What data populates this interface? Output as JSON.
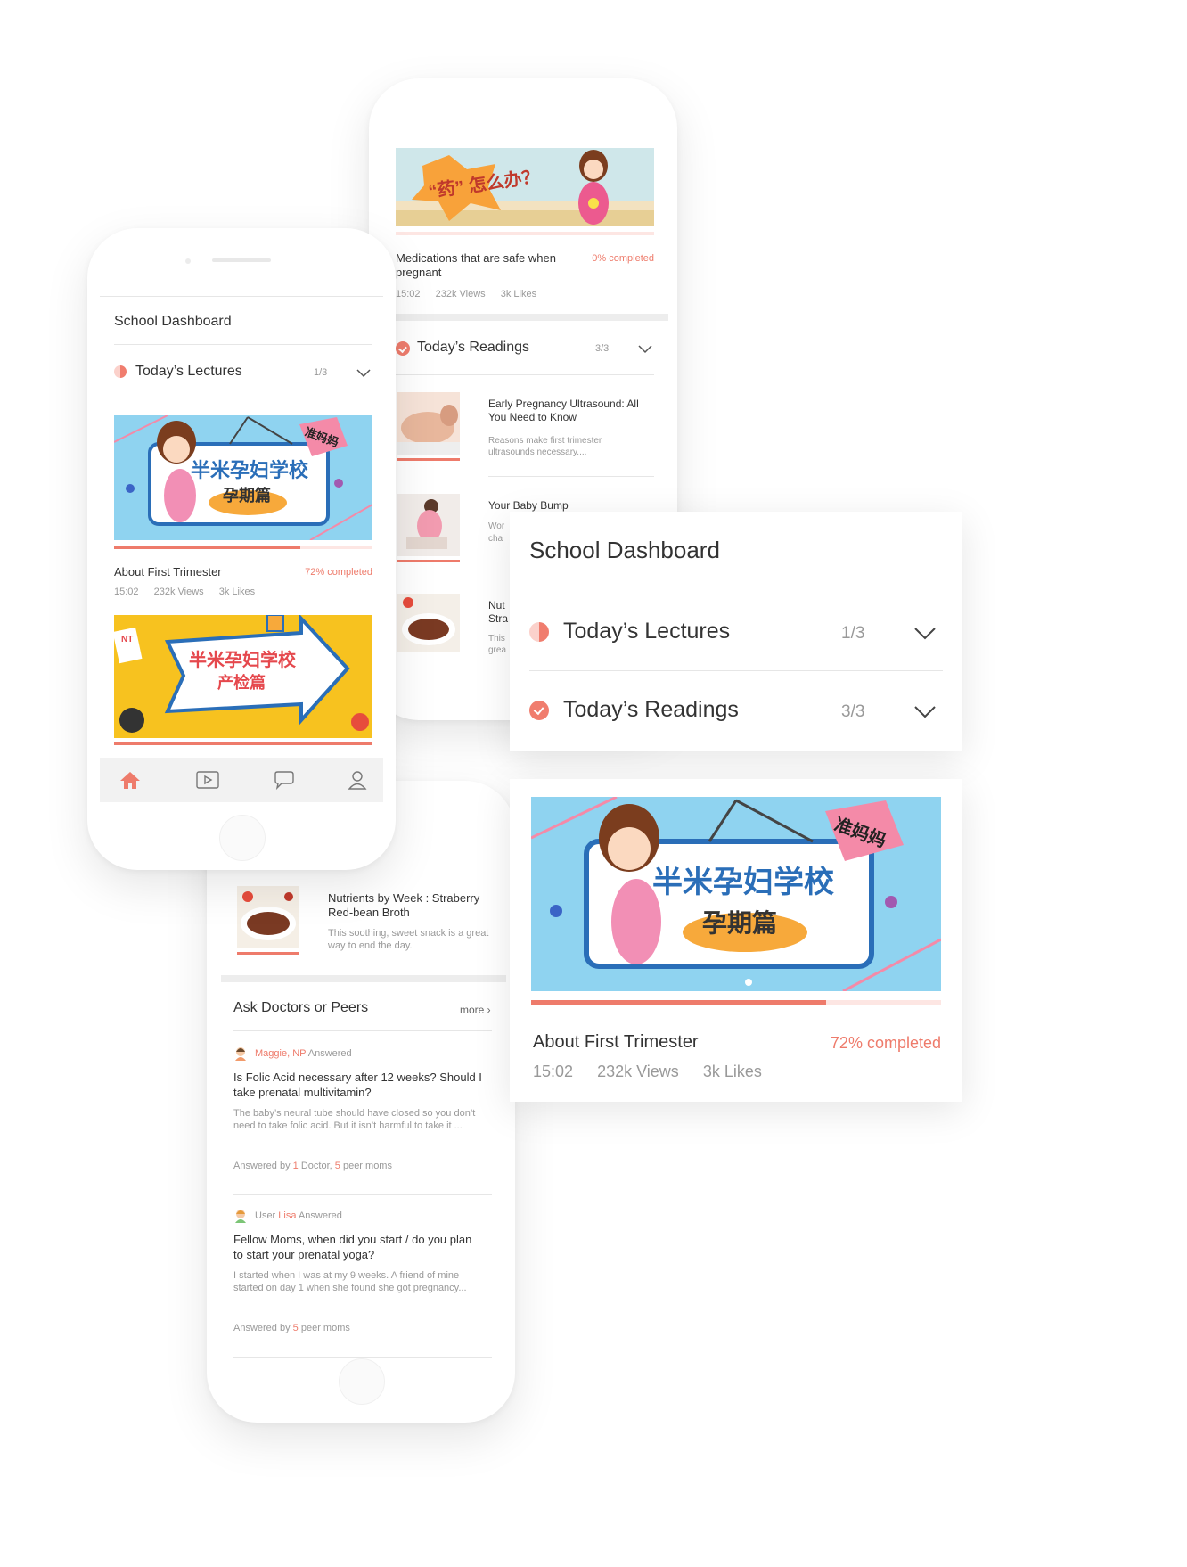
{
  "phone_left": {
    "title": "School Dashboard",
    "lectures": {
      "label": "Today’s Lectures",
      "count": "1/3"
    },
    "lecture1": {
      "banner_text": "半米孕妇学校",
      "banner_sub": "孕期篇",
      "banner_tag": "准妈妈",
      "title": "About First Trimester",
      "progress_label": "72% completed",
      "progress": 0.72,
      "duration": "15:02",
      "views": "232k Views",
      "likes": "3k Likes"
    },
    "lecture2": {
      "banner_text": "半米孕妇学校",
      "banner_sub": "产检篇",
      "banner_badge": "NT"
    },
    "tabbar": [
      "home-icon",
      "video-icon",
      "chat-icon",
      "profile-icon"
    ]
  },
  "phone_top": {
    "banner_text": "“药” 怎么办？",
    "lecture": {
      "title": "Medications that are safe when pregnant",
      "progress_label": "0% completed",
      "progress": 0,
      "duration": "15:02",
      "views": "232k Views",
      "likes": "3k Likes"
    },
    "readings": {
      "label": "Today’s Readings",
      "count": "3/3"
    },
    "articles": [
      {
        "title": "Early Pregnancy Ultrasound: All You Need to Know",
        "desc": "Reasons make first trimester ultrasounds necessary...."
      },
      {
        "title": "Your Baby Bump",
        "desc": "Wor cha"
      },
      {
        "title": "Nut Stra",
        "desc": "This grea"
      }
    ]
  },
  "phone_bottom": {
    "article": {
      "title": "Nutrients by Week : Straberry Red-bean Broth",
      "desc": "This soothing, sweet snack is a great way to end the day."
    },
    "ask": {
      "title": "Ask Doctors or Peers",
      "more": "more ›"
    },
    "questions": [
      {
        "author": "Maggie, NP",
        "answered": "Answered",
        "question": "Is Folic Acid necessary after 12 weeks? Should I take prenatal multivitamin?",
        "answer": "The baby’s neural tube should have closed so you don’t need to take folic acid. But it isn’t harmful to take it ...",
        "stats_prefix": "Answered by",
        "doctors_num": "1",
        "doctors_label": "Doctor,",
        "peers_num": "5",
        "peers_label": "peer moms"
      },
      {
        "author_prefix": "User",
        "author": "Lisa",
        "answered": "Answered",
        "question": "Fellow Moms, when did you start / do you plan to start your prenatal yoga?",
        "answer": "I started when I was at my 9 weeks. A friend of mine started on day 1 when she found she got pregnancy...",
        "stats_prefix": "Answered by",
        "peers_num": "5",
        "peers_label": "peer moms"
      }
    ]
  },
  "zoom_panel": {
    "title": "School Dashboard",
    "lectures": {
      "label": "Today’s Lectures",
      "count": "1/3"
    },
    "readings": {
      "label": "Today’s Readings",
      "count": "3/3"
    }
  },
  "zoom_card": {
    "banner_text": "半米孕妇学校",
    "banner_sub": "孕期篇",
    "banner_tag": "准妈妈",
    "title": "About First Trimester",
    "progress_label": "72% completed",
    "progress": 0.72,
    "duration": "15:02",
    "views": "232k Views",
    "likes": "3k Likes"
  },
  "colors": {
    "accent": "#ee7b6b",
    "banner_blue": "#8fd3f0",
    "banner_yellow": "#f7c21f"
  }
}
